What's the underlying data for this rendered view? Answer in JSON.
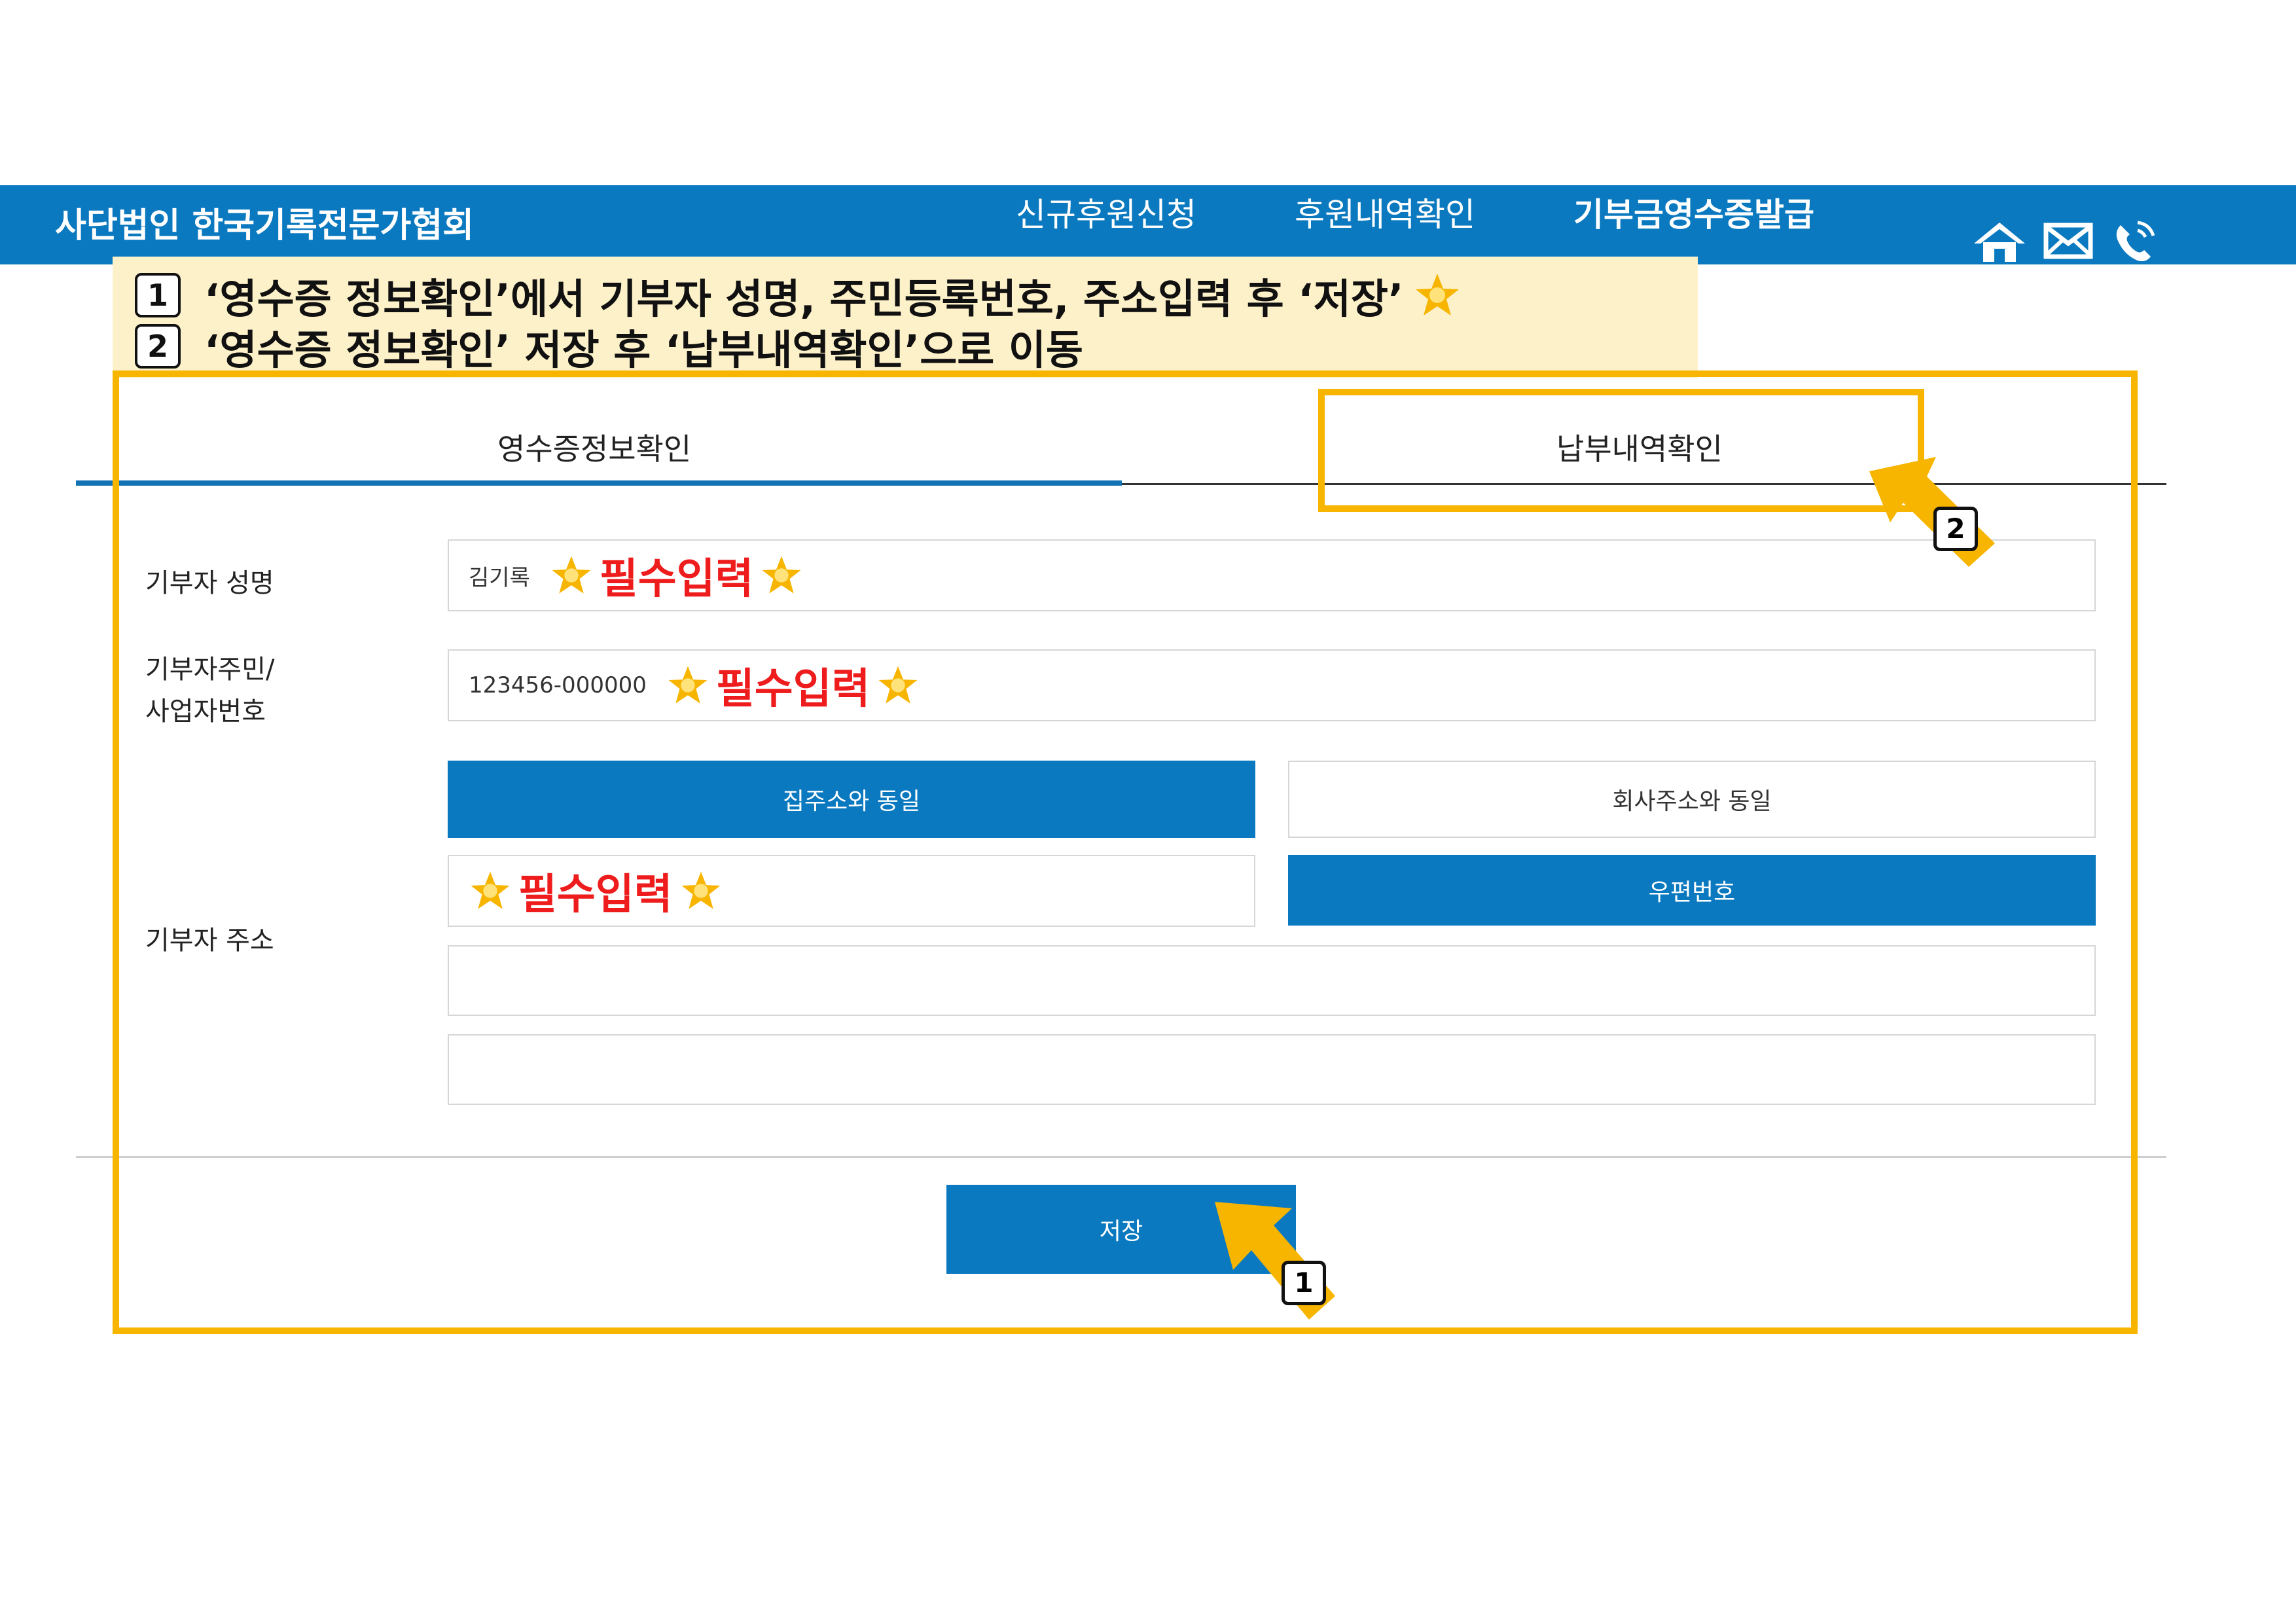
{
  "header": {
    "org_name": "사단법인 한국기록전문가협회",
    "nav": [
      "신규후원신청",
      "후원내역확인",
      "기부금영수증발급"
    ],
    "icons": [
      "home-icon",
      "mail-icon",
      "phone-icon"
    ],
    "color": "#0b79bf"
  },
  "instructions": {
    "line1": {
      "num": "1",
      "text": "‘영수증 정보확인’에서 기부자 성명, 주민등록번호, 주소입력 후 ‘저장’"
    },
    "line2": {
      "num": "2",
      "text": "‘영수증 정보확인’ 저장 후 ‘납부내역확인’으로 이동"
    }
  },
  "tabs": [
    "영수증정보확인",
    "납부내역확인"
  ],
  "form": {
    "name_label": "기부자 성명",
    "name_value": "김기록",
    "id_label_1": "기부자주민/",
    "id_label_2": "사업자번호",
    "id_value": "123456-000000",
    "required_text": "필수입력",
    "home_address_button": "집주소와 동일",
    "company_address_button": "회사주소와 동일",
    "postcode_button": "우편번호",
    "address_label": "기부자 주소",
    "save_button": "저장"
  },
  "annotations": {
    "badge1": "1",
    "badge2": "2",
    "highlight_color": "#f7b500"
  }
}
